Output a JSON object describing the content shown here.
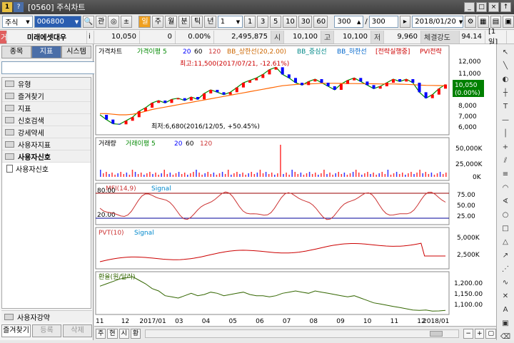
{
  "window": {
    "number": "1",
    "help": "?",
    "title": "[0560] 주식차트"
  },
  "title_buttons": [
    "_",
    "□",
    "×",
    "↑"
  ],
  "toolbar": {
    "market": "주식",
    "code": "006800",
    "search_icon": "magnifier-icon",
    "buttons": [
      "관",
      "◎",
      "±"
    ],
    "period_buttons": [
      "주",
      "월",
      "분",
      "틱",
      "년"
    ],
    "period_active": "일",
    "interval": "1",
    "quick_intervals": [
      "1",
      "3",
      "5",
      "10",
      "30",
      "60"
    ],
    "count_a": "300",
    "count_b": "300",
    "date": "2018/01/20"
  },
  "quote": {
    "stock_name": "미래에셋대우",
    "price": "10,050",
    "change": "0",
    "change_rate": "0.00%",
    "volume": "2,495,875",
    "open_label": "시",
    "open": "10,100",
    "high_label": "고",
    "high": "10,100",
    "low_label": "저",
    "low": "9,960",
    "strength_label": "체결강도",
    "strength": "94.14",
    "period_tag": "[1일]"
  },
  "left_panel": {
    "tabs": [
      "종목",
      "지표",
      "시스템"
    ],
    "active_tab": "지표",
    "tree": [
      {
        "label": "유형",
        "type": "folder"
      },
      {
        "label": "즐겨찾기",
        "type": "folder"
      },
      {
        "label": "지표",
        "type": "folder"
      },
      {
        "label": "신호검색",
        "type": "folder"
      },
      {
        "label": "강세약세",
        "type": "folder"
      },
      {
        "label": "사용자지표",
        "type": "folder"
      },
      {
        "label": "사용자신호",
        "type": "folder-bold"
      },
      {
        "label": "사용자신호",
        "type": "doc"
      }
    ],
    "bottom_item": "사용자강약",
    "bottom_tabs": [
      "즐겨찾기",
      "등록",
      "삭제"
    ]
  },
  "status_buttons": [
    "주",
    "현",
    "시",
    "황"
  ],
  "colors": {
    "candle_up": "#ff0000",
    "candle_down": "#0000ff",
    "ma5": "#008800",
    "ma20": "#0000ff",
    "ma60": "#000000",
    "ma120": "#ff6600",
    "bb": "#cc6600",
    "pvt": "#cc0000",
    "fx": "#336600",
    "price_box": "#008000"
  },
  "chart_data": [
    {
      "type": "line",
      "panel": "price",
      "legend": [
        "가격차트",
        "가격이평 5",
        "20",
        "60",
        "120",
        "BB_상한선(20,2.00)",
        "BB_중심선",
        "BB_하한선",
        "[전략실행중]",
        "PVI전략"
      ],
      "annotations": [
        "최고:11,500(2017/07/21, -12.61%)",
        "최저:6,680(2016/12/05, +50.45%)"
      ],
      "yticks": [
        "12,000",
        "11,000",
        "10,000",
        "9,000",
        "8,000",
        "7,000",
        "6,000"
      ],
      "current_price": "10,050",
      "current_rate": "(0.00%)",
      "series": [
        {
          "name": "가격차트",
          "values": [
            7500,
            7100,
            6750,
            6700,
            7000,
            7300,
            7800,
            8100,
            8500,
            8700,
            8500,
            8800,
            8900,
            8700,
            9000,
            8800,
            9300,
            9600,
            9400,
            9200,
            9400,
            9800,
            10200,
            10400,
            10600,
            10900,
            11300,
            11500,
            10900,
            10600,
            10200,
            10000,
            10300,
            10500,
            10200,
            9900,
            9600,
            10100,
            10400,
            10600,
            10300,
            10000,
            9700,
            9900,
            10200,
            10500,
            10300,
            10500,
            10200,
            9400,
            8900,
            9200,
            9700,
            10050
          ]
        },
        {
          "name": "120",
          "values": [
            7600,
            7600,
            7550,
            7500,
            7500,
            7550,
            7650,
            7800,
            7950,
            8050,
            8150,
            8250,
            8350,
            8450,
            8550,
            8650,
            8750,
            8850,
            8950,
            9050,
            9150,
            9250,
            9350,
            9450,
            9550,
            9650,
            9750,
            9850,
            9950,
            10000,
            10050,
            10100,
            10100,
            10120,
            10150,
            10150,
            10150,
            10140,
            10130,
            10130,
            10120,
            10120,
            10110,
            10100,
            10100,
            10100,
            10080,
            10060,
            10040,
            10000,
            9980,
            9970,
            9960,
            9950
          ]
        }
      ]
    },
    {
      "type": "bar",
      "panel": "volume",
      "legend": [
        "거래량",
        "거래이평 5",
        "20",
        "60",
        "120"
      ],
      "yticks": [
        "50,000K",
        "25,000K",
        "0K"
      ]
    },
    {
      "type": "line",
      "panel": "indicator",
      "legend": [
        "MFI(14,9)",
        "Signal"
      ],
      "levels": [
        "80.00",
        "20.00"
      ],
      "yticks": [
        "75.00",
        "50.00",
        "25.00"
      ]
    },
    {
      "type": "line",
      "panel": "indicator",
      "legend": [
        "PVT(10)",
        "Signal"
      ],
      "yticks": [
        "5,000K",
        "2,500K"
      ]
    },
    {
      "type": "line",
      "panel": "indicator",
      "legend": [
        "환율(원/달러)"
      ],
      "yticks": [
        "1,200.00",
        "1,150.00",
        "1,100.00"
      ],
      "series": [
        {
          "name": "환율(원/달러)",
          "values": [
            1170,
            1180,
            1190,
            1200,
            1205,
            1210,
            1195,
            1180,
            1160,
            1150,
            1130,
            1125,
            1120,
            1130,
            1140,
            1130,
            1135,
            1145,
            1140,
            1130,
            1135,
            1140,
            1145,
            1135,
            1130,
            1130,
            1125,
            1130,
            1140,
            1145,
            1150,
            1145,
            1140,
            1150,
            1145,
            1140,
            1135,
            1130,
            1125,
            1130,
            1120,
            1110,
            1100,
            1095,
            1090,
            1085,
            1080,
            1075,
            1070,
            1068,
            1070,
            1065,
            1066,
            1068
          ]
        }
      ]
    }
  ],
  "xaxis_ticks": [
    "11",
    "12",
    "2017/01",
    "03",
    "04",
    "05",
    "06",
    "07",
    "08",
    "09",
    "10",
    "11",
    "12",
    "2018/01"
  ]
}
